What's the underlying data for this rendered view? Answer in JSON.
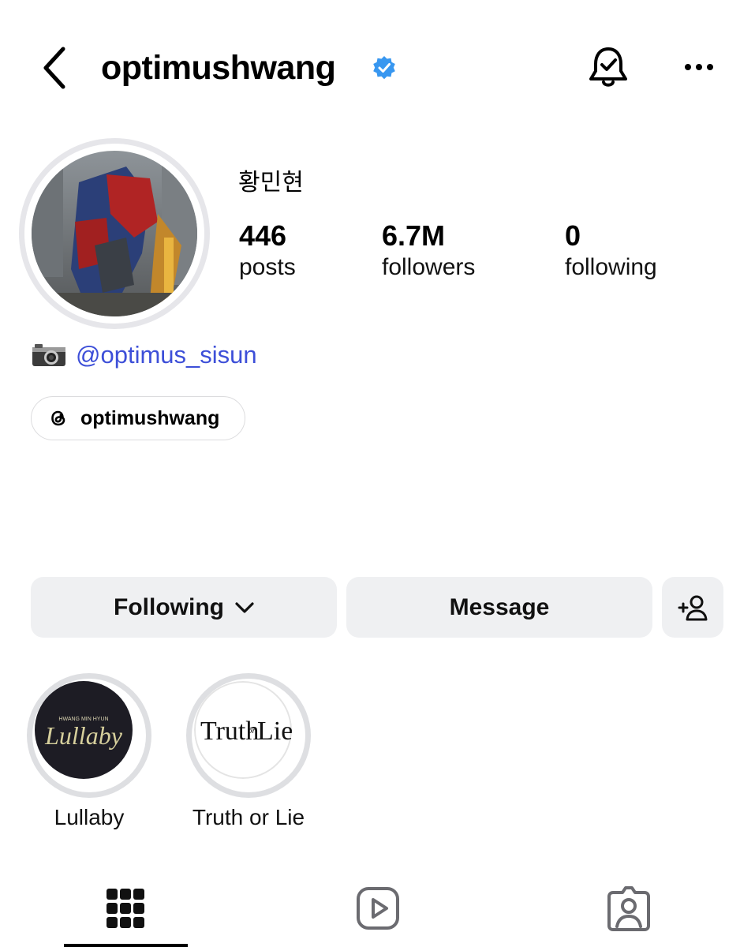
{
  "header": {
    "username": "optimushwang",
    "verified": true,
    "icons": {
      "back": "chevron-left-icon",
      "verified": "verified-badge-icon",
      "notifications": "bell-check-icon",
      "more": "more-horizontal-icon"
    }
  },
  "profile": {
    "full_name": "황민현",
    "avatar_icon": "profile-photo-robot",
    "stats": {
      "posts": {
        "value": "446",
        "label": "posts"
      },
      "followers": {
        "value": "6.7M",
        "label": "followers"
      },
      "following": {
        "value": "0",
        "label": "following"
      }
    },
    "bio": {
      "emoji_icon": "camera-icon",
      "link_text": "@optimus_sisun"
    },
    "threads": {
      "icon": "threads-icon",
      "label": "optimushwang"
    }
  },
  "actions": {
    "following_label": "Following",
    "message_label": "Message",
    "add_user_icon": "add-user-icon"
  },
  "highlights": [
    {
      "label": "Lullaby",
      "cover_text_small": "HWANG MIN HYUN",
      "cover_text": "Lullaby"
    },
    {
      "label": "Truth or Lie",
      "cover_text": "Truth",
      "cover_text_mid": "or",
      "cover_text_end": "Lie"
    }
  ],
  "tabs": [
    {
      "name": "grid",
      "icon": "grid-icon",
      "active": true
    },
    {
      "name": "reels",
      "icon": "reels-play-icon",
      "active": false
    },
    {
      "name": "tagged",
      "icon": "tagged-person-icon",
      "active": false
    }
  ],
  "colors": {
    "link": "#3d4fd8",
    "verified": "#3897f0",
    "button_bg": "#eff0f2"
  }
}
